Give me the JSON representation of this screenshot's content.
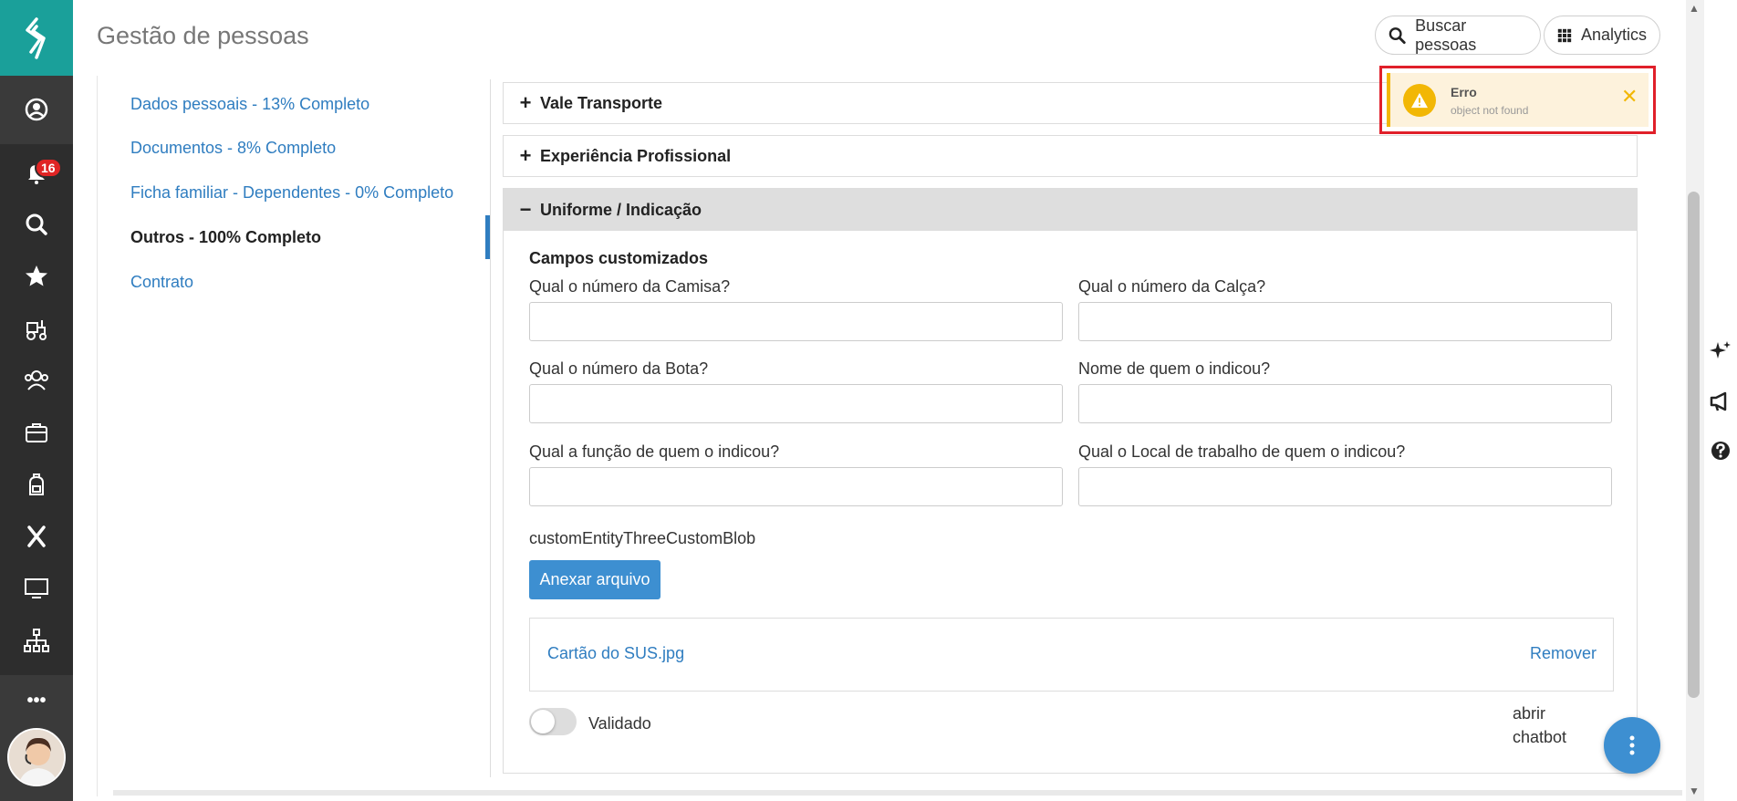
{
  "header": {
    "title": "Gestão de pessoas",
    "search_people_label": "Buscar pessoas",
    "analytics_label": "Analytics"
  },
  "rail": {
    "notifications_count": "16",
    "icons": [
      "profile-icon",
      "bell-icon",
      "search-icon",
      "star-icon",
      "tractor-icon",
      "team-icon",
      "briefcase-icon",
      "backpack-icon",
      "x-icon",
      "monitor-icon",
      "org-chart-icon"
    ],
    "more_label": "•••"
  },
  "sections": [
    {
      "label": "Dados pessoais - 13% Completo",
      "active": false
    },
    {
      "label": "Documentos - 8% Completo",
      "active": false
    },
    {
      "label": "Ficha familiar - Dependentes - 0% Completo",
      "active": false
    },
    {
      "label": "Outros - 100% Completo",
      "active": true
    },
    {
      "label": "Contrato",
      "active": false
    }
  ],
  "accordion": {
    "vale_transporte": {
      "sign": "+",
      "title": "Vale Transporte"
    },
    "experiencia": {
      "sign": "+",
      "title": "Experiência Profissional"
    },
    "uniforme": {
      "sign": "−",
      "title": "Uniforme / Indicação"
    }
  },
  "form": {
    "section_title": "Campos customizados",
    "fields": [
      {
        "label": "Qual o número da Camisa?",
        "value": ""
      },
      {
        "label": "Qual o número da Calça?",
        "value": ""
      },
      {
        "label": "Qual o número da Bota?",
        "value": ""
      },
      {
        "label": "Nome de quem o indicou?",
        "value": ""
      },
      {
        "label": "Qual a função de quem o indicou?",
        "value": ""
      },
      {
        "label": "Qual o Local de trabalho de quem o indicou?",
        "value": ""
      }
    ],
    "blob_label": "customEntityThreeCustomBlob",
    "attach_label": "Anexar arquivo",
    "file_name": "Cartão do SUS.jpg",
    "remove_label": "Remover",
    "validated_label": "Validado",
    "validated": false,
    "chatbot_alt": "abrir chatbot"
  },
  "toast": {
    "title": "Erro",
    "message": "object not found",
    "close": "✕"
  },
  "colors": {
    "brand_teal": "#1aa09a",
    "rail_dark": "#2d2d2d",
    "link_blue": "#2f7dc0",
    "primary_button": "#3d8fd1",
    "warning_yellow": "#f2b705",
    "toast_bg": "#fdf2dc",
    "highlight_red": "#e0202a"
  }
}
